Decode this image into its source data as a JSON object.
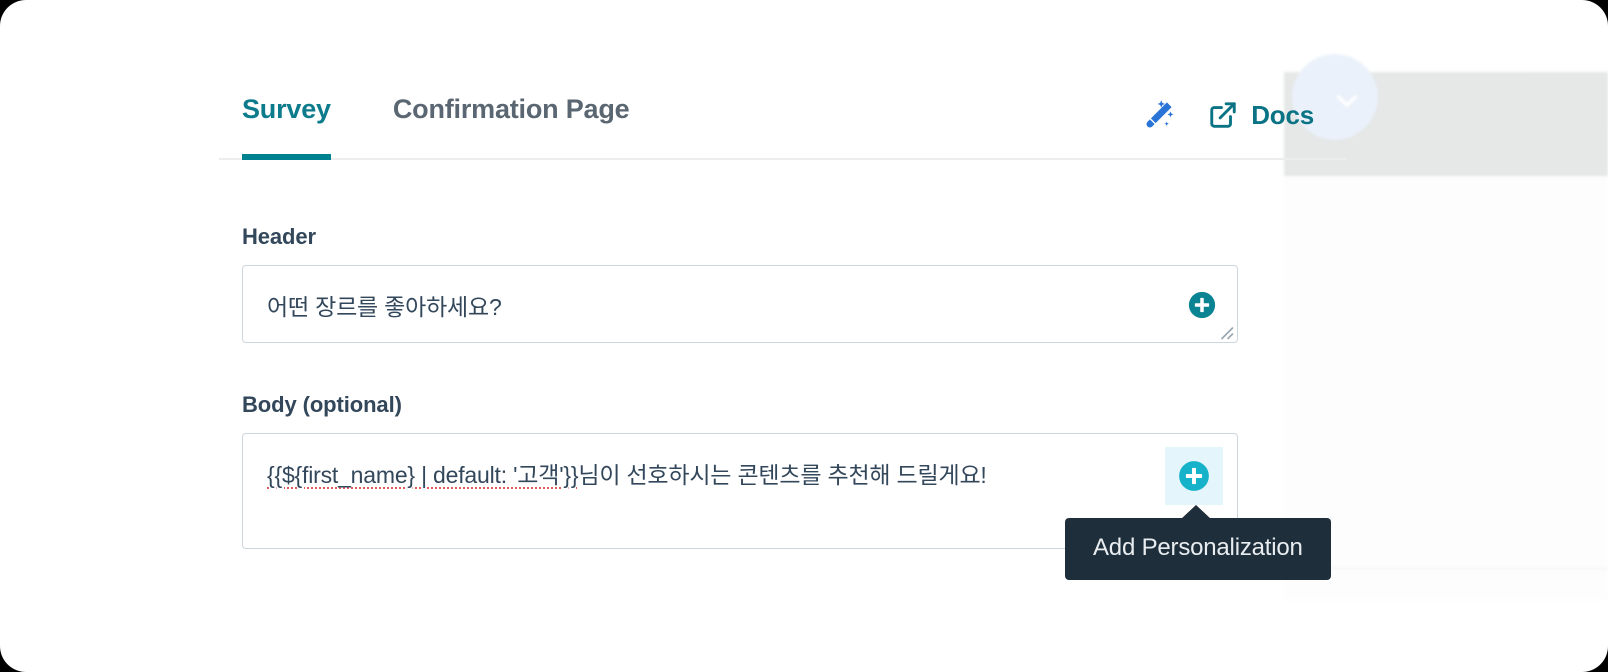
{
  "tabs": [
    {
      "label": "Survey",
      "active": true
    },
    {
      "label": "Confirmation Page",
      "active": false
    }
  ],
  "actions": {
    "wand_icon": "magic-wand-icon",
    "docs_label": "Docs",
    "docs_icon": "external-link-icon"
  },
  "fields": {
    "header": {
      "label": "Header",
      "value": "어떤 장르를 좋아하세요?",
      "add_personalization_icon": "circle-plus-icon",
      "resize_icon": "resize-handle-icon"
    },
    "body": {
      "label": "Body (optional)",
      "value_token": "{{${first_name} | default: '고객'}}",
      "value_rest": "님이 선호하시는 콘텐츠를 추천해 드릴게요!",
      "add_personalization_icon": "circle-plus-icon"
    }
  },
  "tooltip": {
    "text": "Add Personalization"
  },
  "colors": {
    "tab_active": "#0c7b8c",
    "tab_underline": "#00818f",
    "tab_inactive": "#5a6671",
    "docs_link": "#0a7384",
    "wand": "#2a74d8",
    "plus_header": "#0a8492",
    "plus_body": "#16b2c9",
    "plus_body_bg": "#e4f6fb",
    "tooltip_bg": "#1f2e3b",
    "field_border": "#cbd6dd",
    "label_text": "#33475b",
    "token_underline": "#e05c5c"
  }
}
